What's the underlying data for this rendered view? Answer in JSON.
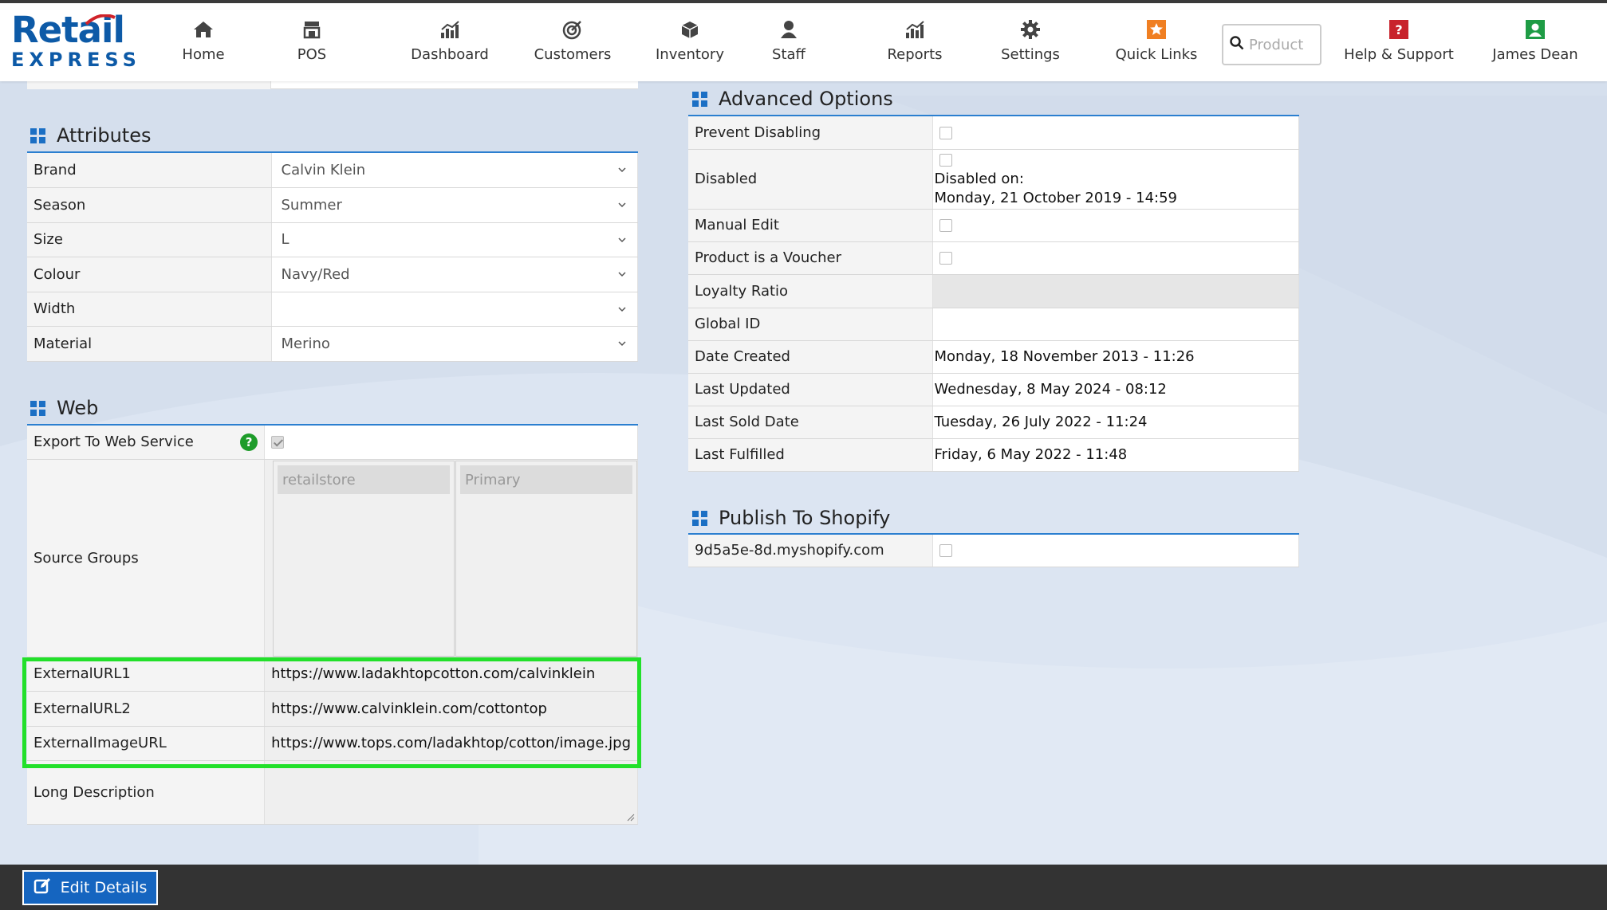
{
  "brand": {
    "line1": "Retail",
    "line2": "EXPRESS"
  },
  "nav": [
    {
      "label": "Home",
      "icon": "home-icon"
    },
    {
      "label": "POS",
      "icon": "store-icon"
    },
    {
      "label": "Dashboard",
      "icon": "bar-chart-icon"
    },
    {
      "label": "Customers",
      "icon": "target-icon"
    },
    {
      "label": "Inventory",
      "icon": "box-icon"
    },
    {
      "label": "Staff",
      "icon": "person-icon"
    },
    {
      "label": "Reports",
      "icon": "bar-chart-icon"
    },
    {
      "label": "Settings",
      "icon": "gear-icon"
    },
    {
      "label": "Quick Links",
      "icon": "star-icon"
    },
    {
      "label": "Help & Support",
      "icon": "question-icon"
    },
    {
      "label": "James Dean",
      "icon": "user-icon"
    }
  ],
  "search": {
    "placeholder": "Product"
  },
  "attributes": {
    "title": "Attributes",
    "rows": [
      {
        "label": "Brand",
        "value": "Calvin Klein"
      },
      {
        "label": "Season",
        "value": "Summer"
      },
      {
        "label": "Size",
        "value": "L"
      },
      {
        "label": "Colour",
        "value": "Navy/Red"
      },
      {
        "label": "Width",
        "value": ""
      },
      {
        "label": "Material",
        "value": "Merino"
      }
    ]
  },
  "web": {
    "title": "Web",
    "export_label": "Export To Web Service",
    "export_checked": true,
    "source_groups_label": "Source Groups",
    "source_groups": [
      "retailstore",
      "Primary"
    ],
    "external": [
      {
        "label": "ExternalURL1",
        "value": "https://www.ladakhtopcotton.com/calvinklein"
      },
      {
        "label": "ExternalURL2",
        "value": "https://www.calvinklein.com/cottontop"
      },
      {
        "label": "ExternalImageURL",
        "value": "https://www.tops.com/ladakhtop/cotton/image.jpg"
      }
    ],
    "long_description_label": "Long Description",
    "long_description": ""
  },
  "advanced": {
    "title": "Advanced Options",
    "prevent_disabling": "Prevent Disabling",
    "disabled": "Disabled",
    "disabled_on_label": "Disabled on:",
    "disabled_on_value": "Monday, 21 October 2019 - 14:59",
    "manual_edit": "Manual Edit",
    "voucher": "Product is a Voucher",
    "loyalty_ratio": "Loyalty Ratio",
    "global_id": "Global ID",
    "dates": [
      {
        "label": "Date Created",
        "value": "Monday, 18 November 2013 - 11:26"
      },
      {
        "label": "Last Updated",
        "value": "Wednesday, 8 May 2024 - 08:12"
      },
      {
        "label": "Last Sold Date",
        "value": "Tuesday, 26 July 2022 - 11:24"
      },
      {
        "label": "Last Fulfilled",
        "value": "Friday, 6 May 2022 - 11:48"
      }
    ]
  },
  "shopify": {
    "title": "Publish To Shopify",
    "store": "9d5a5e-8d.myshopify.com"
  },
  "footer": {
    "edit_label": "Edit Details"
  },
  "colors": {
    "accent": "#1b6fc4",
    "highlight": "#22e02a",
    "footer": "#333333",
    "button": "#1565c0"
  }
}
